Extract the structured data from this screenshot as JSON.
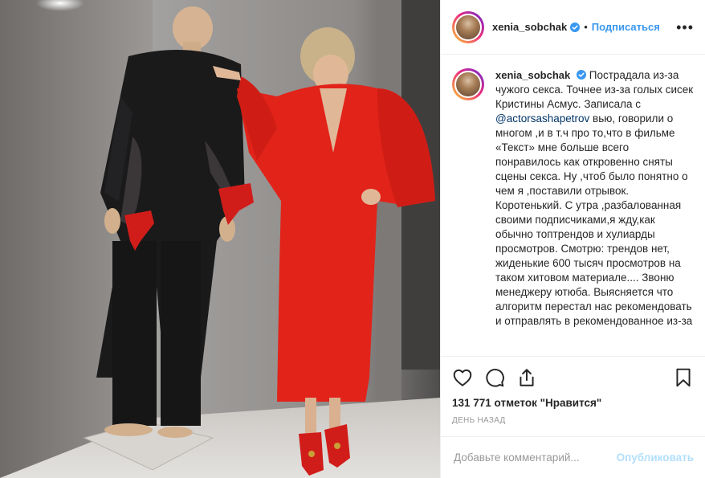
{
  "post": {
    "username": "xenia_sobchak",
    "follow_label": "Подписаться",
    "separator": "•",
    "more_label": "•••",
    "caption_username": "xenia_sobchak",
    "caption_part1": "Пострадала из-за чужого секса. Точнее из-за голых сисек Кристины Асмус. Записала с ",
    "mention": "@actorsashapetrov",
    "caption_part2": " вью, говорили о многом ,и в т.ч про то,что в фильме «Текст» мне больше всего понравилось как откровенно сняты сцены секса. Ну ,чтоб было понятно о чем я ,поставили отрывок. Коротенький. С утра ,разбалованная своими подписчиками,я жду,как обычно топтрендов и хулиарды просмотров. Смотрю: трендов нет, жиденькие 600 тысяч просмотров на таком хитовом материале.... Звоню менеджеру ютюба. Выясняется что алгоритм перестал нас рекомендовать и отправлять в рекомендованное из-за",
    "likes": "131 771 отметок \"Нравится\"",
    "time": "ДЕНЬ НАЗАД"
  },
  "comment_box": {
    "placeholder": "Добавьте комментарий...",
    "publish_label": "Опубликовать"
  },
  "colors": {
    "accent": "#3897f0",
    "verified": "#3897f0",
    "dress": "#e2231a",
    "publish_disabled": "#b2dffc"
  }
}
